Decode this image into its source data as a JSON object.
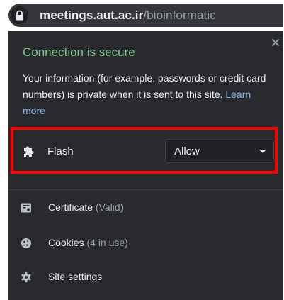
{
  "address_bar": {
    "host": "meetings.aut.ac.ir",
    "path": "/bioinformatic"
  },
  "popup": {
    "title": "Connection is secure",
    "description": "Your information (for example, passwords or credit card numbers) is private when it is sent to this site.",
    "learn_more": "Learn more",
    "permission": {
      "label": "Flash",
      "icon": "puzzle-icon",
      "selected": "Allow"
    },
    "items": [
      {
        "label": "Certificate",
        "sub": "(Valid)",
        "icon": "certificate-icon"
      },
      {
        "label": "Cookies",
        "sub": "(4 in use)",
        "icon": "cookie-icon"
      },
      {
        "label": "Site settings",
        "sub": "",
        "icon": "gear-icon"
      }
    ]
  },
  "colors": {
    "secure_green": "#81c995",
    "link_blue": "#8ab4f8",
    "popup_bg": "#292a2d",
    "highlight_red": "#ff0000"
  }
}
